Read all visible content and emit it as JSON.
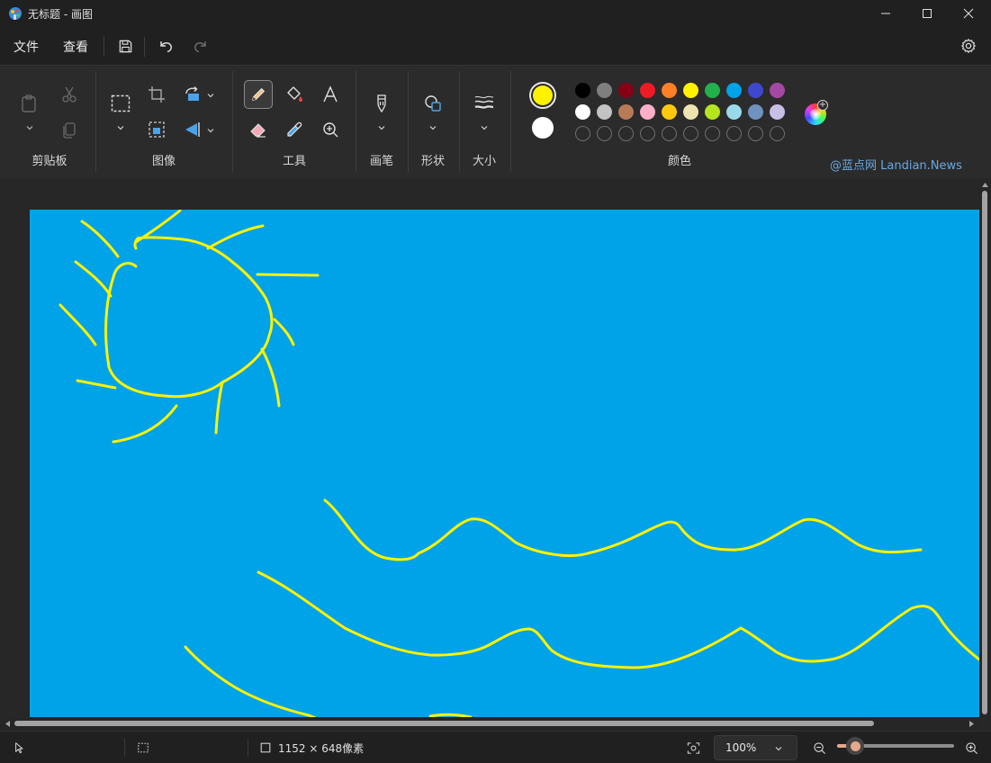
{
  "window": {
    "title": "无标题 - 画图",
    "icons": [
      "paint-app-icon",
      "minimize-icon",
      "maximize-icon",
      "close-icon"
    ]
  },
  "menu": {
    "file_label": "文件",
    "view_label": "查看",
    "icons": [
      "save-icon",
      "undo-icon",
      "redo-icon",
      "settings-icon"
    ]
  },
  "ribbon": {
    "groups": {
      "clipboard": "剪贴板",
      "image": "图像",
      "tools": "工具",
      "brushes": "画笔",
      "shapes": "形状",
      "size": "大小",
      "colors": "颜色"
    },
    "active_tool": "pencil",
    "tool_icons": [
      "paste-icon",
      "cut-icon",
      "copy-icon",
      "select-icon",
      "crop-icon",
      "resize-icon",
      "rotate-icon",
      "flip-icon",
      "pencil-icon",
      "fill-icon",
      "text-icon",
      "eraser-icon",
      "color-picker-icon",
      "magnifier-icon",
      "brush-icon",
      "shapes-icon",
      "stroke-size-icon"
    ]
  },
  "colors": {
    "primary": "#FFF200",
    "secondary": "#FFFFFF",
    "palette_row1": [
      "#000000",
      "#7F7F7F",
      "#880015",
      "#ED1C24",
      "#FF7F27",
      "#FFF200",
      "#22B14C",
      "#00A2E8",
      "#3F48CC",
      "#A349A4"
    ],
    "palette_row2": [
      "#FFFFFF",
      "#C3C3C3",
      "#B97A57",
      "#FFAEC9",
      "#FFC90E",
      "#EFE4B0",
      "#B5E61D",
      "#99D9EA",
      "#7092BE",
      "#C8BFE7"
    ],
    "custom_slots": 10,
    "canvas_fill": "#00A2E8",
    "stroke": "#FFF200"
  },
  "watermark": "@蓝点网 Landian.News",
  "status": {
    "canvas_size": "1152 × 648像素",
    "zoom": "100%",
    "zoom_fraction": 0.15,
    "icons": [
      "pointer-icon",
      "selection-size-icon",
      "canvas-size-icon",
      "fit-to-window-icon",
      "zoom-out-icon",
      "zoom-in-icon"
    ]
  }
}
